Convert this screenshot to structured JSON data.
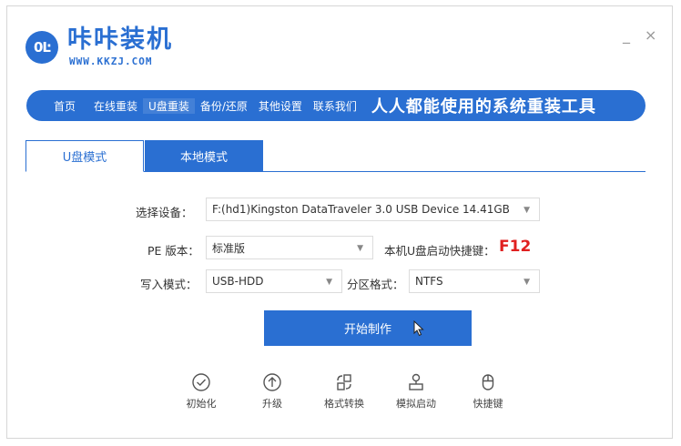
{
  "app": {
    "logo_text": "0Ŀ",
    "title": "咔咔装机",
    "url": "WWW.KKZJ.COM",
    "minimize": "_",
    "close": "×"
  },
  "nav": {
    "items": [
      "首页",
      "在线重装",
      "U盘重装",
      "备份/还原",
      "其他设置",
      "联系我们"
    ],
    "active_index": 2,
    "slogan": "人人都能使用的系统重装工具"
  },
  "tabs": [
    {
      "label": "U盘模式",
      "active": true
    },
    {
      "label": "本地模式",
      "active": false
    }
  ],
  "form": {
    "device_label": "选择设备：",
    "device_value": "F:(hd1)Kingston DataTraveler 3.0 USB Device 14.41GB",
    "pe_label": "PE 版本：",
    "pe_value": "标准版",
    "hotkey_label": "本机U盘启动快捷键：",
    "hotkey_value": "F12",
    "write_label": "写入模式：",
    "write_value": "USB-HDD",
    "partition_label": "分区格式：",
    "partition_value": "NTFS"
  },
  "start_button": "开始制作",
  "tools": [
    {
      "label": "初始化",
      "icon": "check-circle-icon"
    },
    {
      "label": "升级",
      "icon": "upload-circle-icon"
    },
    {
      "label": "格式转换",
      "icon": "convert-icon"
    },
    {
      "label": "模拟启动",
      "icon": "usb-simulate-icon"
    },
    {
      "label": "快捷键",
      "icon": "mouse-icon"
    }
  ],
  "colors": {
    "accent": "#2a6fd2",
    "hotkey": "#e02020"
  }
}
